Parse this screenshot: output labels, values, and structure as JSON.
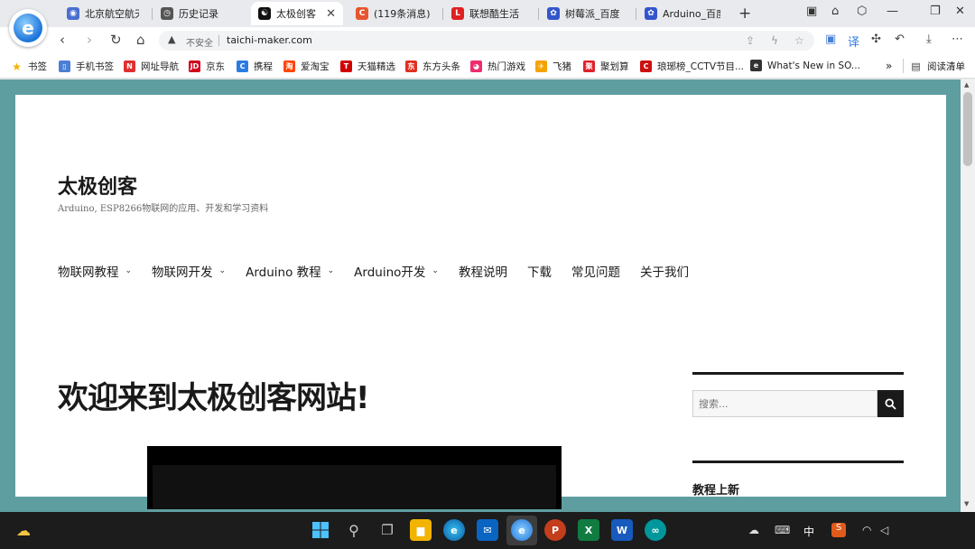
{
  "browser": {
    "tabs": [
      {
        "label": "北京航空航天",
        "fav_color": "#4a6fd0",
        "fav_glyph": "◉"
      },
      {
        "label": "历史记录",
        "fav_color": "#555555",
        "fav_glyph": "◷"
      },
      {
        "label": "太极创客",
        "fav_color": "#111111",
        "fav_glyph": "☯",
        "active": true
      },
      {
        "label": "(119条消息)",
        "fav_color": "#e8542f",
        "fav_glyph": "C"
      },
      {
        "label": "联想酷生活",
        "fav_color": "#e02020",
        "fav_glyph": "L"
      },
      {
        "label": "树莓派_百度",
        "fav_color": "#3355cc",
        "fav_glyph": "✿"
      },
      {
        "label": "Arduino_百度",
        "fav_color": "#3355cc",
        "fav_glyph": "✿"
      }
    ],
    "tab_close_glyph": "✕",
    "new_tab_glyph": "+",
    "address": {
      "insecure_label": "不安全",
      "url": "taichi-maker.com"
    },
    "bookmarks": [
      {
        "label": "书签",
        "color": "#f0b400",
        "glyph": "★"
      },
      {
        "label": "手机书签",
        "color": "#4a7fd4",
        "glyph": "▯"
      },
      {
        "label": "网址导航",
        "color": "#e03030",
        "glyph": "N"
      },
      {
        "label": "京东",
        "color": "#d0021b",
        "glyph": "JD"
      },
      {
        "label": "携程",
        "color": "#2b7be0",
        "glyph": "C"
      },
      {
        "label": "爱淘宝",
        "color": "#ff4400",
        "glyph": "淘"
      },
      {
        "label": "天猫精选",
        "color": "#d00000",
        "glyph": "T"
      },
      {
        "label": "东方头条",
        "color": "#e03020",
        "glyph": "东"
      },
      {
        "label": "热门游戏",
        "color": "#ee2d6d",
        "glyph": "◕"
      },
      {
        "label": "飞猪",
        "color": "#f5a300",
        "glyph": "✈"
      },
      {
        "label": "聚划算",
        "color": "#e0202a",
        "glyph": "聚"
      },
      {
        "label": "琅琊榜_CCTV节目...",
        "color": "#cc1010",
        "glyph": "C"
      },
      {
        "label": "What's New in SO...",
        "color": "#333333",
        "glyph": "e"
      }
    ],
    "more_glyph": "»",
    "reading_list": "阅读清单"
  },
  "site": {
    "title": "太极创客",
    "description": "Arduino, ESP8266物联网的应用、开发和学习资料",
    "menu": [
      {
        "label": "物联网教程",
        "has_dropdown": true
      },
      {
        "label": "物联网开发",
        "has_dropdown": true
      },
      {
        "label": "Arduino 教程",
        "has_dropdown": true
      },
      {
        "label": "Arduino开发",
        "has_dropdown": true
      },
      {
        "label": "教程说明",
        "has_dropdown": false
      },
      {
        "label": "下载",
        "has_dropdown": false
      },
      {
        "label": "常见问题",
        "has_dropdown": false
      },
      {
        "label": "关于我们",
        "has_dropdown": false
      }
    ],
    "welcome_heading": "欢迎来到太极创客网站!",
    "search": {
      "placeholder": "搜索..."
    },
    "sidebar_heading": "教程上新"
  },
  "taskbar": {
    "ime_label": "中"
  }
}
